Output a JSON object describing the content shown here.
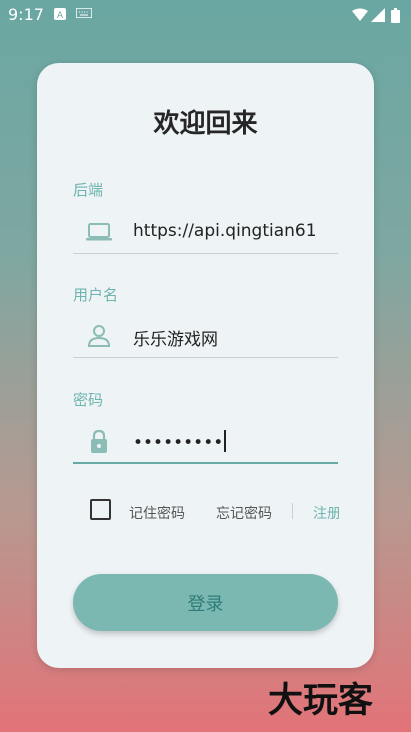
{
  "status_bar": {
    "time": "9:17"
  },
  "card": {
    "title": "欢迎回来",
    "backend": {
      "label": "后端",
      "value": "https://api.qingtian61",
      "icon": "laptop-icon"
    },
    "username": {
      "label": "用户名",
      "value": "乐乐游戏网",
      "icon": "person-icon"
    },
    "password": {
      "label": "密码",
      "value": "•••••••••",
      "icon": "lock-icon"
    },
    "remember_label": "记住密码",
    "forgot_label": "忘记密码",
    "register_label": "注册",
    "login_label": "登录"
  },
  "watermark": "大玩客",
  "colors": {
    "accent": "#6fb4ae",
    "button": "#7bb8b2",
    "card": "#eef3f6"
  }
}
